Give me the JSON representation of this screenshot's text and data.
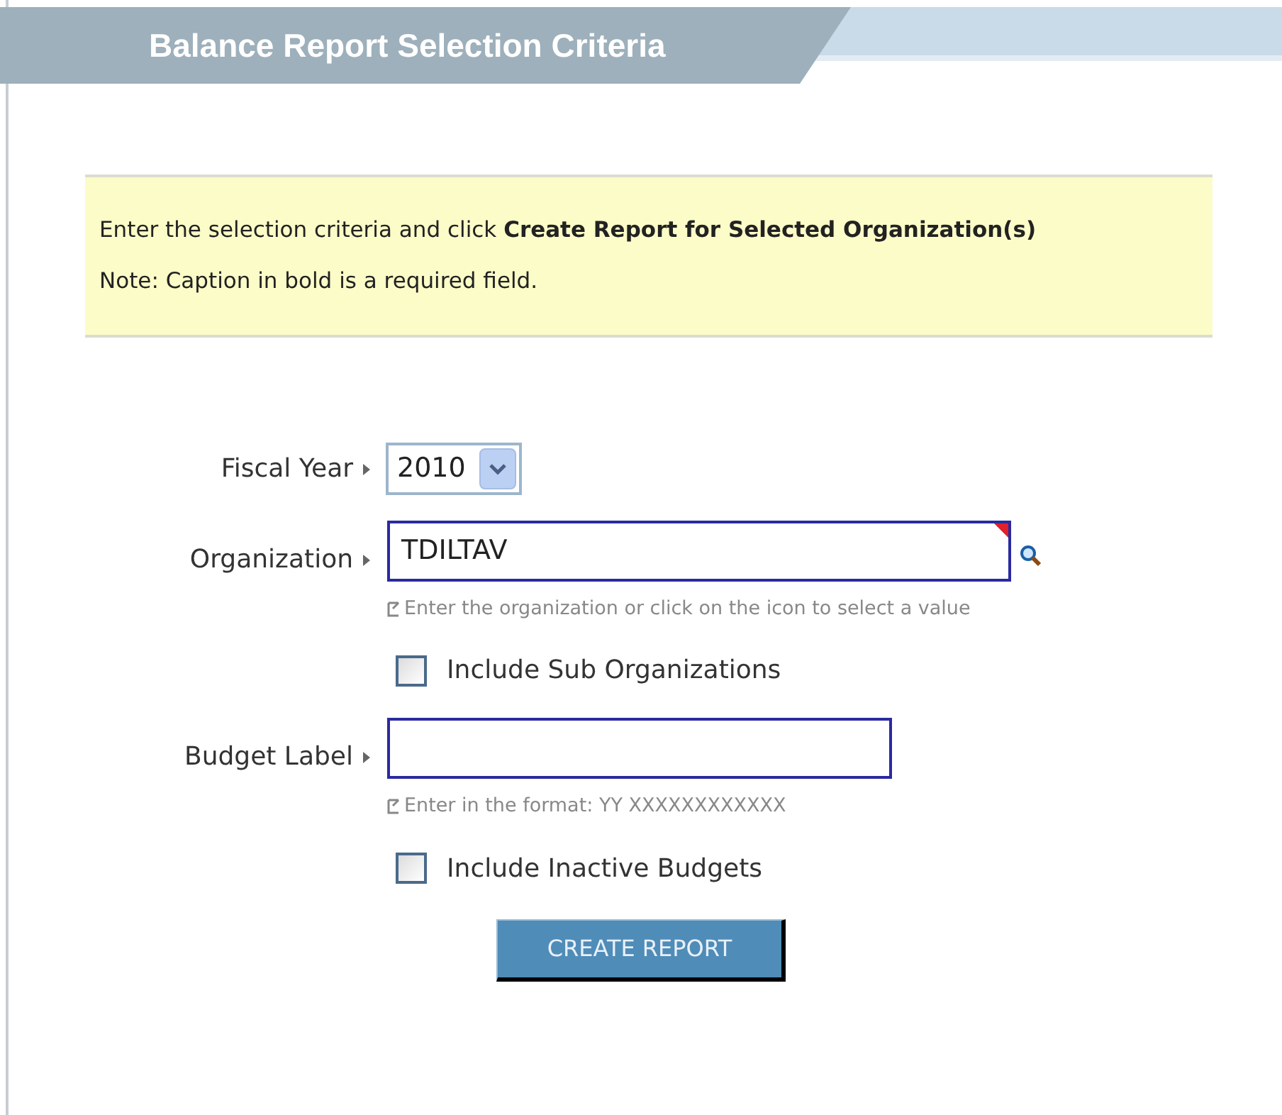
{
  "title": "Balance Report Selection Criteria",
  "instructions": [
    "Enter the selection criteria and click **Create Report for Selected Organization(s)**",
    "Note: Caption in bold is a required field."
  ],
  "fields": [
    {
      "kind": "select",
      "label": "Fiscal Year",
      "value": "2010"
    },
    {
      "kind": "lookup",
      "label": "Organization",
      "value": "TDILTAV",
      "required": true,
      "hint": "Enter the organization or click on the icon to select a value"
    },
    {
      "kind": "checkbox",
      "label": "Include Sub Organizations",
      "checked": false
    },
    {
      "kind": "text",
      "label": "Budget Label",
      "hint": "Enter in the format: YY XXXXXXXXXXXX"
    },
    {
      "kind": "checkbox",
      "label": "Include Inactive Budgets",
      "checked": false
    }
  ],
  "button": "CREATE REPORT"
}
